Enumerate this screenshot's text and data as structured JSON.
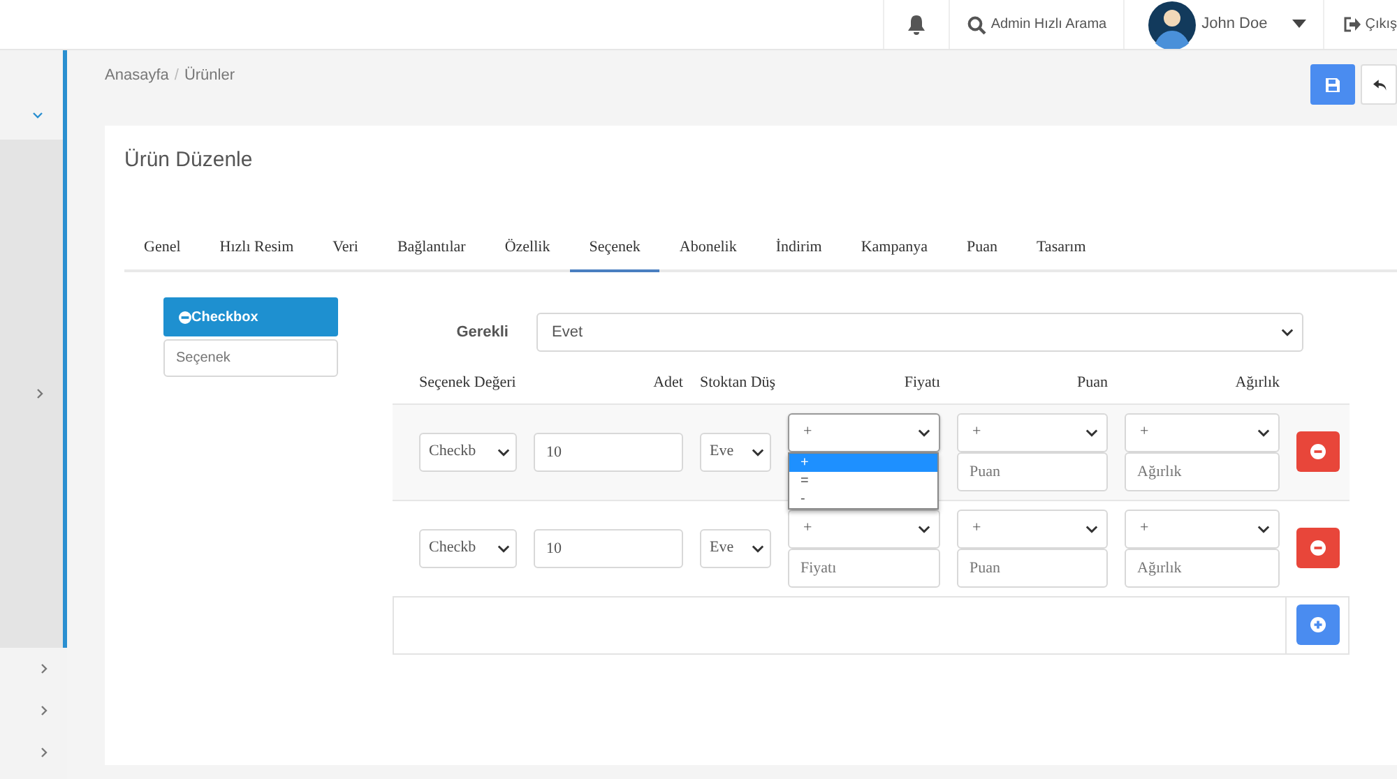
{
  "topbar": {
    "search_label": "Admin Hızlı Arama",
    "user_name": "John Doe",
    "logout_label": "Çıkış"
  },
  "sidebar": {
    "items": [
      {
        "expanded": true,
        "children": [
          {
            "expanded": false
          }
        ]
      },
      {
        "expanded": false
      },
      {
        "expanded": false
      },
      {
        "expanded": false
      }
    ]
  },
  "breadcrumb": {
    "items": [
      "Anasayfa",
      "Ürünler"
    ],
    "separator": "/"
  },
  "card": {
    "title": "Ürün Düzenle"
  },
  "tabs": [
    {
      "label": "Genel",
      "selected": false
    },
    {
      "label": "Hızlı Resim",
      "selected": false
    },
    {
      "label": "Veri",
      "selected": false
    },
    {
      "label": "Bağlantılar",
      "selected": false
    },
    {
      "label": "Özellik",
      "selected": false
    },
    {
      "label": "Seçenek",
      "selected": true
    },
    {
      "label": "Abonelik",
      "selected": false
    },
    {
      "label": "İndirim",
      "selected": false
    },
    {
      "label": "Kampanya",
      "selected": false
    },
    {
      "label": "Puan",
      "selected": false
    },
    {
      "label": "Tasarım",
      "selected": false
    }
  ],
  "option_panel": [
    {
      "kind": "button",
      "label": "Checkbox"
    },
    {
      "kind": "input",
      "placeholder": "Seçenek"
    }
  ],
  "required": {
    "label": "Gerekli",
    "value": "Evet"
  },
  "columns": [
    "Seçenek Değeri",
    "Adet",
    "Stoktan Düş",
    "Fiyatı",
    "Puan",
    "Ağırlık"
  ],
  "rows": [
    {
      "option_value": "Checkb",
      "quantity": "10",
      "subtract_stock": "Eve",
      "price": {
        "operator": "+",
        "open": true,
        "options": [
          {
            "label": "+",
            "selected": true
          },
          {
            "label": "=",
            "selected": false
          },
          {
            "label": "-",
            "selected": false
          }
        ]
      },
      "points": {
        "operator": "+",
        "placeholder": "Puan"
      },
      "weight": {
        "operator": "+",
        "placeholder": "Ağırlık"
      }
    },
    {
      "option_value": "Checkb",
      "quantity": "10",
      "subtract_stock": "Eve",
      "price": {
        "operator": "+",
        "open": false,
        "placeholder": "Fiyatı"
      },
      "points": {
        "operator": "+",
        "placeholder": "Puan"
      },
      "weight": {
        "operator": "+",
        "placeholder": "Ağırlık"
      }
    }
  ]
}
